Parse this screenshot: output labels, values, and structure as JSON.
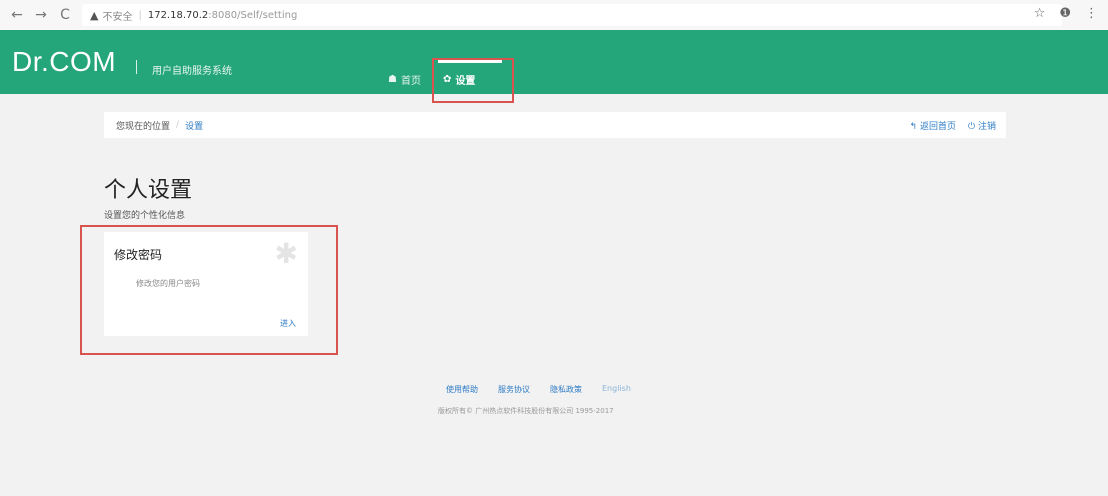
{
  "browser": {
    "back_icon": "←",
    "forward_icon": "→",
    "reload_icon": "C",
    "warning_icon": "▲",
    "security_text": "不安全",
    "host": "172.18.70.2",
    "path": ":8080/Self/setting",
    "star_icon": "☆",
    "account_icon": "❶",
    "menu_icon": "⋮"
  },
  "header": {
    "logo": "Dr.COM",
    "system_name": "用户自助服务系统",
    "nav": [
      {
        "icon": "☗",
        "label": "首页"
      },
      {
        "icon": "✿",
        "label": "设置"
      }
    ]
  },
  "breadcrumb": {
    "location_label": "您现在的位置",
    "current": "设置",
    "back_icon": "↰",
    "back_label": "返回首页",
    "logout_icon": "⏻",
    "logout_label": "注销"
  },
  "page": {
    "title": "个人设置",
    "subtitle": "设置您的个性化信息"
  },
  "card": {
    "title": "修改密码",
    "description": "修改您的用户密码",
    "link": "进入",
    "icon": "✱"
  },
  "footer": {
    "links": [
      "使用帮助",
      "服务协议",
      "隐私政策",
      "English"
    ],
    "copyright": "版权所有© 广州热点软件科技股份有限公司 1995-2017"
  },
  "colors": {
    "header": "#24a57a",
    "highlight_box": "#d9534f",
    "link": "#2d7bc4"
  }
}
